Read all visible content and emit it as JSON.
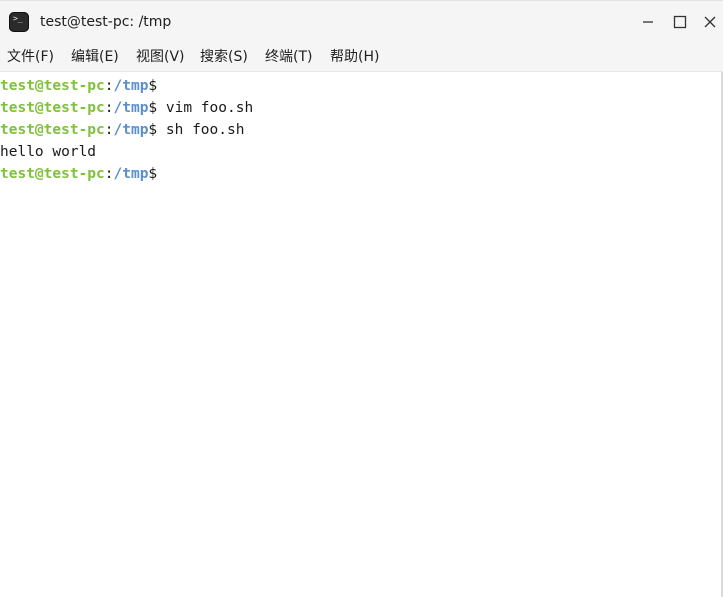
{
  "window": {
    "title": "test@test-pc: /tmp",
    "app_icon": "terminal-icon",
    "controls": {
      "minimize_icon": "minimize-icon",
      "maximize_icon": "maximize-icon",
      "close_icon": "close-icon"
    }
  },
  "menu": {
    "items": [
      {
        "label": "文件(F)"
      },
      {
        "label": "编辑(E)"
      },
      {
        "label": "视图(V)"
      },
      {
        "label": "搜索(S)"
      },
      {
        "label": "终端(T)"
      },
      {
        "label": "帮助(H)"
      }
    ]
  },
  "terminal": {
    "lines": [
      {
        "type": "prompt",
        "user": "test@test-pc",
        "colon": ":",
        "path": "/tmp",
        "dollar": "$",
        "command": ""
      },
      {
        "type": "prompt",
        "user": "test@test-pc",
        "colon": ":",
        "path": "/tmp",
        "dollar": "$",
        "command": " vim foo.sh"
      },
      {
        "type": "prompt",
        "user": "test@test-pc",
        "colon": ":",
        "path": "/tmp",
        "dollar": "$",
        "command": " sh foo.sh"
      },
      {
        "type": "output",
        "text": "hello world"
      },
      {
        "type": "prompt",
        "user": "test@test-pc",
        "colon": ":",
        "path": "/tmp",
        "dollar": "$",
        "command": ""
      }
    ],
    "colors": {
      "user": "#7fc13a",
      "path": "#5a8fd0",
      "text": "#1a1a1a",
      "background": "#ffffff"
    }
  }
}
